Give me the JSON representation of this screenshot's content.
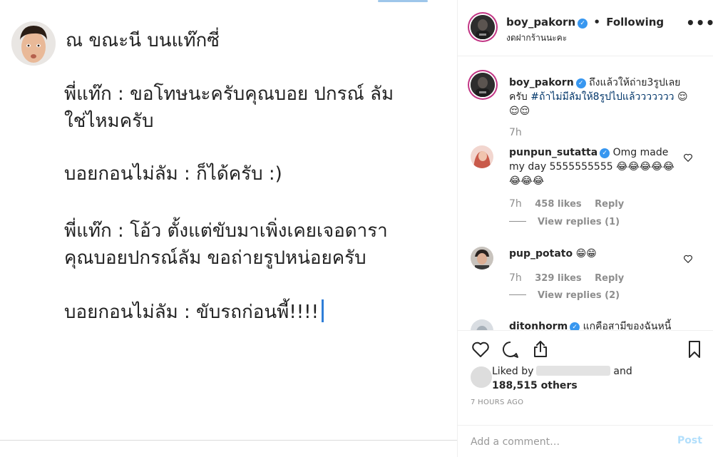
{
  "post_image": {
    "title": "ณ ขณะนี บนแท๊กซี่",
    "lines": [
      "พี่แท๊ก : ขอโทษนะครับคุณบอย ปกรณ์ ลัม",
      "ใช่ไหมครับ",
      "บอยกอนไม่ลัม : ก็ได้ครับ :)",
      "พี่แท๊ก : โอ้ว ตั้งแต่ขับมาเพิ่งเคยเจอดารา",
      "คุณบอยปกรณ์ลัม ขอถ่ายรูปหน่อยครับ",
      "บอยกอนไม่ลัม : ขับรถก่อนพี้!!!!"
    ]
  },
  "header": {
    "username": "boy_pakorn",
    "follow_label": "Following",
    "dot": "•",
    "location": "งดฝากร้านนะคะ",
    "more": "•••"
  },
  "caption": {
    "username": "boy_pakorn",
    "text": "ถึงแล้วให้ถ่าย3รูปเลยครับ",
    "hashtag": "#ถ้าไม่มีลัมให้8รูปไปแล้ววววววว",
    "emoji": "😌😌😌",
    "time": "7h"
  },
  "comments": [
    {
      "username": "punpun_sutatta",
      "text": "Omg made my day 5555555555 😂😂😂😂😂😂😂😂",
      "time": "7h",
      "likes": "458 likes",
      "reply": "Reply",
      "view_replies": "View replies (1)"
    },
    {
      "username": "pup_potato",
      "text": "😁😁",
      "time": "7h",
      "likes": "329 likes",
      "reply": "Reply",
      "view_replies": "View replies (2)"
    },
    {
      "username": "ditonhorm",
      "text": "แกคือสามีของฉันหนี้"
    }
  ],
  "actions": {
    "liked_by": "Liked by",
    "and": "and",
    "others": "188,515 others",
    "post_time": "7 HOURS AGO"
  },
  "comment_box": {
    "placeholder": "Add a comment…",
    "post_label": "Post"
  },
  "colors": {
    "link_blue": "#003569",
    "verified_blue": "#3897f0",
    "post_disabled": "#b2dffc",
    "muted": "#8e8e8e"
  }
}
